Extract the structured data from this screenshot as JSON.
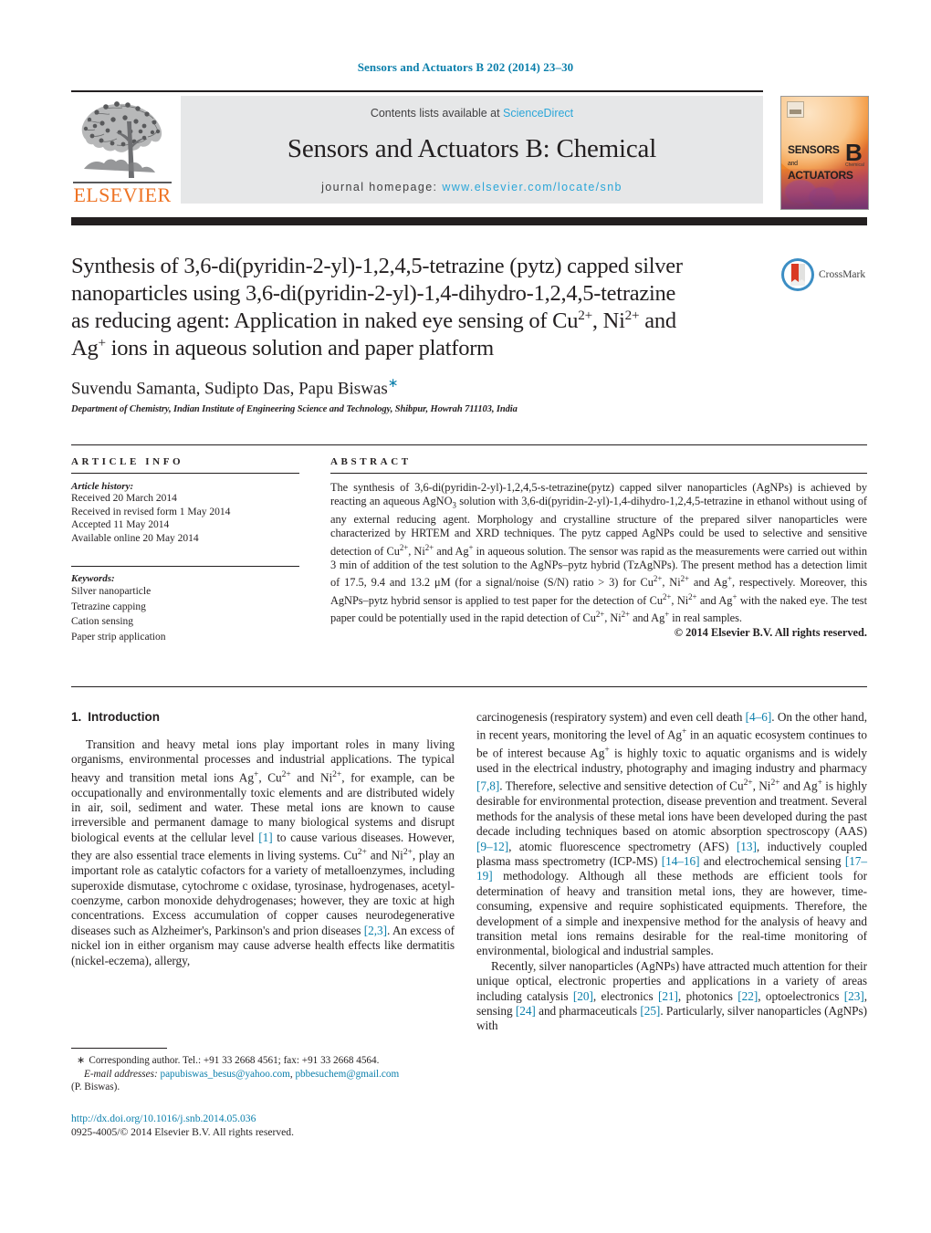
{
  "running_head": "Sensors and Actuators B 202 (2014) 23–30",
  "masthead": {
    "contents_prefix": "Contents lists available at ",
    "sciencedirect": "ScienceDirect",
    "journal_title": "Sensors and Actuators B: Chemical",
    "homepage_prefix": "journal homepage:",
    "homepage_url": "www.elsevier.com/locate/snb",
    "publisher": "ELSEVIER",
    "cover": {
      "line1": "SENSORS",
      "line1_small": "and",
      "line2": "ACTUATORS",
      "letter": "B",
      "letter_sub": "Chemical"
    },
    "accent_blue": "#2ba6d8",
    "elsevier_orange": "#ee7324",
    "band_gray": "#e6e7e8"
  },
  "crossmark": {
    "label": "CrossMark"
  },
  "title": {
    "line1": "Synthesis of 3,6-di(pyridin-2-yl)-1,2,4,5-tetrazine (pytz) capped silver",
    "line2": "nanoparticles using 3,6-di(pyridin-2-yl)-1,4-dihydro-1,2,4,5-tetrazine",
    "line3_a": "as reducing agent: Application in naked eye sensing of Cu",
    "line3_sup1": "2+",
    "line3_b": ", Ni",
    "line3_sup2": "2+",
    "line3_c": " and",
    "line4_a": "Ag",
    "line4_sup": "+",
    "line4_b": " ions in aqueous solution and paper platform"
  },
  "authors": {
    "names": "Suvendu Samanta, Sudipto Das, Papu Biswas",
    "corresponding_marker": "∗",
    "affiliation": "Department of Chemistry, Indian Institute of Engineering Science and Technology, Shibpur, Howrah 711103, India"
  },
  "article_info": {
    "heading": "ARTICLE INFO",
    "history_label": "Article history:",
    "history": [
      "Received 20 March 2014",
      "Received in revised form 1 May 2014",
      "Accepted 11 May 2014",
      "Available online 20 May 2014"
    ],
    "keywords_label": "Keywords:",
    "keywords": [
      "Silver nanoparticle",
      "Tetrazine capping",
      "Cation sensing",
      "Paper strip application"
    ]
  },
  "abstract": {
    "heading": "ABSTRACT",
    "text_parts": [
      {
        "t": "The synthesis of 3,6-di(pyridin-2-yl)-1,2,4,5-s-tetrazine(pytz) capped silver nanoparticles (AgNPs) is achieved by reacting an aqueous AgNO"
      },
      {
        "sub": "3"
      },
      {
        "t": " solution with 3,6-di(pyridin-2-yl)-1,4-dihydro-1,2,4,5-tetrazine in ethanol without using of any external reducing agent. Morphology and crystalline structure of the prepared silver nanoparticles were characterized by HRTEM and XRD techniques. The pytz capped AgNPs could be used to selective and sensitive detection of Cu"
      },
      {
        "sup": "2+"
      },
      {
        "t": ", Ni"
      },
      {
        "sup": "2+"
      },
      {
        "t": " and Ag"
      },
      {
        "sup": "+"
      },
      {
        "t": " in aqueous solution. The sensor was rapid as the measurements were carried out within 3 min of addition of the test solution to the AgNPs–pytz hybrid (TzAgNPs). The present method has a detection limit of 17.5, 9.4 and 13.2 μM (for a signal/noise (S/N) ratio > 3) for Cu"
      },
      {
        "sup": "2+"
      },
      {
        "t": ", Ni"
      },
      {
        "sup": "2+"
      },
      {
        "t": " and Ag"
      },
      {
        "sup": "+"
      },
      {
        "t": ", respectively. Moreover, this AgNPs–pytz hybrid sensor is applied to test paper for the detection of Cu"
      },
      {
        "sup": "2+"
      },
      {
        "t": ", Ni"
      },
      {
        "sup": "2+"
      },
      {
        "t": " and Ag"
      },
      {
        "sup": "+"
      },
      {
        "t": " with the naked eye. The test paper could be potentially used in the rapid detection of Cu"
      },
      {
        "sup": "2+"
      },
      {
        "t": ", Ni"
      },
      {
        "sup": "2+"
      },
      {
        "t": " and Ag"
      },
      {
        "sup": "+"
      },
      {
        "t": " in real samples."
      }
    ],
    "copyright": "© 2014 Elsevier B.V. All rights reserved."
  },
  "body": {
    "section_number": "1.",
    "section_title": "Introduction",
    "left_paragraphs": [
      [
        {
          "t": "Transition and heavy metal ions play important roles in many living organisms, environmental processes and industrial applications. The typical heavy and transition metal ions Ag"
        },
        {
          "sup": "+"
        },
        {
          "t": ", Cu"
        },
        {
          "sup": "2+"
        },
        {
          "t": " and Ni"
        },
        {
          "sup": "2+"
        },
        {
          "t": ", for example, can be occupationally and environmentally toxic elements and are distributed widely in air, soil, sediment and water. These metal ions are known to cause irreversible and permanent damage to many biological systems and disrupt biological events at the cellular level "
        },
        {
          "ref": "[1]"
        },
        {
          "t": " to cause various diseases. However, they are also essential trace elements in living systems. Cu"
        },
        {
          "sup": "2+"
        },
        {
          "t": " and Ni"
        },
        {
          "sup": "2+"
        },
        {
          "t": ", play an important role as catalytic cofactors for a variety of metalloenzymes, including superoxide dismutase, cytochrome c oxidase, tyrosinase, hydrogenases, acetyl-coenzyme, carbon monoxide dehydrogenases; however, they are toxic at high concentrations. Excess accumulation of copper causes neurodegenerative diseases such as Alzheimer's, Parkinson's and prion diseases "
        },
        {
          "ref": "[2,3]"
        },
        {
          "t": ". An excess of nickel ion in either organism may cause adverse health effects like dermatitis (nickel-eczema), allergy,"
        }
      ]
    ],
    "right_paragraphs": [
      [
        {
          "t": "carcinogenesis (respiratory system) and even cell death "
        },
        {
          "ref": "[4–6]"
        },
        {
          "t": ". On the other hand, in recent years, monitoring the level of Ag"
        },
        {
          "sup": "+"
        },
        {
          "t": " in an aquatic ecosystem continues to be of interest because Ag"
        },
        {
          "sup": "+"
        },
        {
          "t": " is highly toxic to aquatic organisms and is widely used in the electrical industry, photography and imaging industry and pharmacy "
        },
        {
          "ref": "[7,8]"
        },
        {
          "t": ". Therefore, selective and sensitive detection of Cu"
        },
        {
          "sup": "2+"
        },
        {
          "t": ", Ni"
        },
        {
          "sup": "2+"
        },
        {
          "t": " and Ag"
        },
        {
          "sup": "+"
        },
        {
          "t": " is highly desirable for environmental protection, disease prevention and treatment. Several methods for the analysis of these metal ions have been developed during the past decade including techniques based on atomic absorption spectroscopy (AAS) "
        },
        {
          "ref": "[9–12]"
        },
        {
          "t": ", atomic fluorescence spectrometry (AFS) "
        },
        {
          "ref": "[13]"
        },
        {
          "t": ", inductively coupled plasma mass spectrometry (ICP-MS) "
        },
        {
          "ref": "[14–16]"
        },
        {
          "t": " and electrochemical sensing "
        },
        {
          "ref": "[17–19]"
        },
        {
          "t": " methodology. Although all these methods are efficient tools for determination of heavy and transition metal ions, they are however, time-consuming, expensive and require sophisticated equipments. Therefore, the development of a simple and inexpensive method for the analysis of heavy and transition metal ions remains desirable for the real-time monitoring of environmental, biological and industrial samples."
        }
      ],
      [
        {
          "t": "Recently, silver nanoparticles (AgNPs) have attracted much attention for their unique optical, electronic properties and applications in a variety of areas including catalysis "
        },
        {
          "ref": "[20]"
        },
        {
          "t": ", electronics "
        },
        {
          "ref": "[21]"
        },
        {
          "t": ", photonics "
        },
        {
          "ref": "[22]"
        },
        {
          "t": ", optoelectronics "
        },
        {
          "ref": "[23]"
        },
        {
          "t": ", sensing "
        },
        {
          "ref": "[24]"
        },
        {
          "t": " and pharmaceuticals "
        },
        {
          "ref": "[25]"
        },
        {
          "t": ". Particularly, silver nanoparticles (AgNPs) with"
        }
      ]
    ]
  },
  "footnotes": {
    "star": "∗",
    "corresponding": "Corresponding author. Tel.: +91 33 2668 4561; fax: +91 33 2668 4564.",
    "email_label": "E-mail addresses:",
    "email1": "papubiswas_besus@yahoo.com",
    "email_sep": ", ",
    "email2": "pbbesuchem@gmail.com",
    "email_owner": "(P. Biswas)."
  },
  "doi": {
    "url": "http://dx.doi.org/10.1016/j.snb.2014.05.036",
    "issn_line": "0925-4005/© 2014 Elsevier B.V. All rights reserved."
  }
}
